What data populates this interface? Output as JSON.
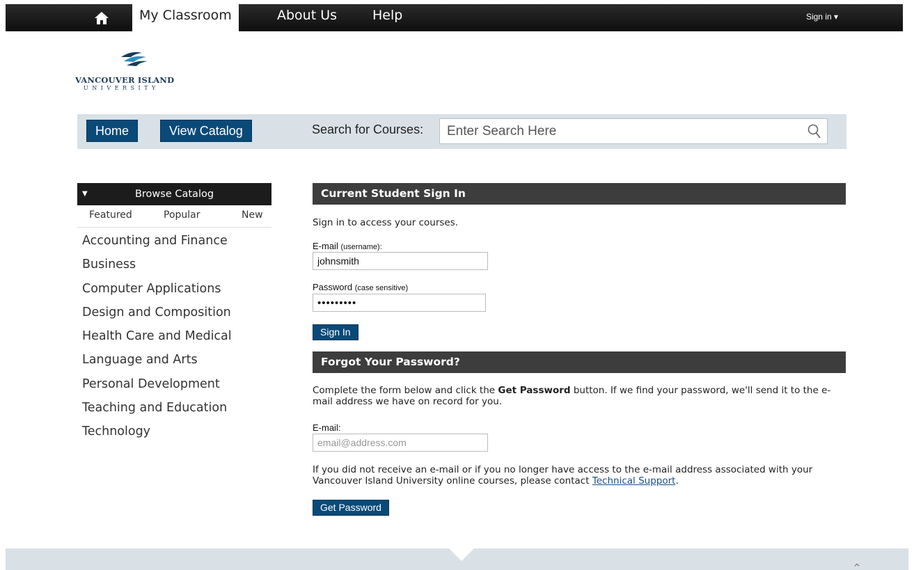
{
  "topnav": {
    "tabs": [
      "My Classroom",
      "About Us",
      "Help"
    ],
    "signin_menu": "Sign in ▾"
  },
  "logo": {
    "name": "VANCOUVER ISLAND",
    "sub": "UNIVERSITY"
  },
  "navbar": {
    "home_label": "Home",
    "catalog_label": "View Catalog",
    "search_label": "Search for Courses:",
    "search_placeholder": "Enter Search Here"
  },
  "sidebar": {
    "title": "Browse Catalog",
    "tabs": [
      "Featured",
      "Popular",
      "New"
    ],
    "categories": [
      "Accounting and Finance",
      "Business",
      "Computer Applications",
      "Design and Composition",
      "Health Care and Medical",
      "Language and Arts",
      "Personal Development",
      "Teaching and Education",
      "Technology"
    ]
  },
  "signin": {
    "heading": "Current Student Sign In",
    "intro": "Sign in to access your courses.",
    "email_label": "E-mail",
    "email_hint": "(username):",
    "email_value": "johnsmith",
    "password_label": "Password",
    "password_hint": "(case sensitive)",
    "password_value": "•••••••••",
    "button": "Sign In"
  },
  "forgot": {
    "heading": "Forgot Your Password?",
    "intro_pre": "Complete the form below and click the ",
    "intro_bold": "Get Password",
    "intro_post": " button. If we find your password, we'll send it to the e-mail address we have on record for you.",
    "email_label": "E-mail:",
    "email_placeholder": "email@address.com",
    "note_pre": "If you did not receive an e-mail or if you no longer have access to the e-mail address associated with your Vancouver Island University online courses, please contact ",
    "note_link": "Technical Support",
    "note_post": ".",
    "button": "Get Password"
  },
  "colors": {
    "accent": "#0a4a78",
    "bar": "#d9e1e6",
    "header": "#3d3d3d"
  }
}
